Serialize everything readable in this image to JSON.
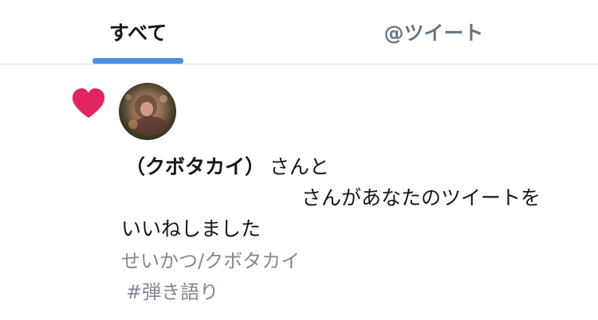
{
  "tabs": {
    "all_label": "すべて",
    "tweets_label": "@ツイート",
    "active": "すべて"
  },
  "colors": {
    "accent": "#4a90e2",
    "heart": "#e0245e",
    "muted_text": "#657786"
  },
  "notification": {
    "icon": "heart-icon",
    "user_name": "（クボタカイ）",
    "connector": "さんと",
    "line2": "さんがあなたのツイートを",
    "line3": "いいねしました",
    "tweet_line1": "せいかつ/クボタカイ",
    "tweet_line2": "#弾き語り"
  }
}
